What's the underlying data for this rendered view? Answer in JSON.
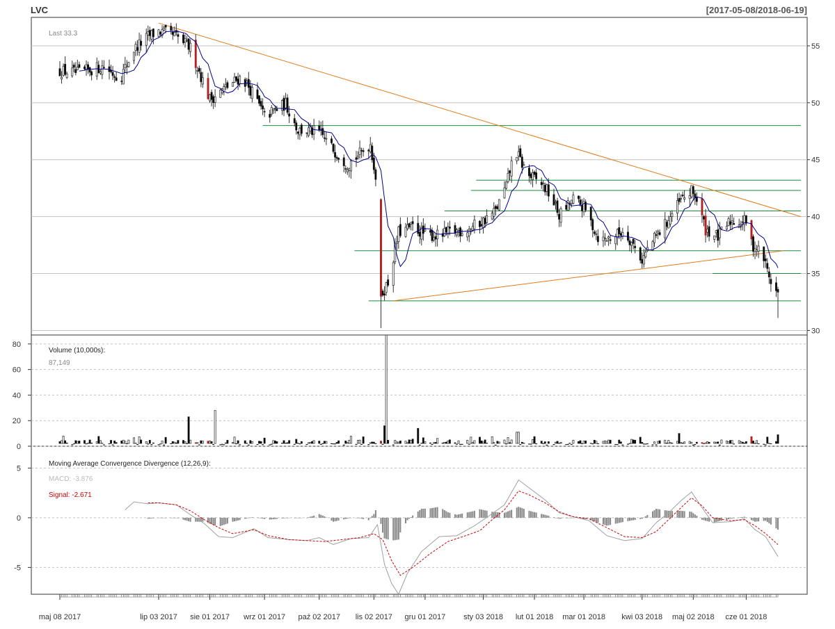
{
  "header": {
    "symbol": "LVC",
    "date_range": "[2017-05-08/2018-06-19]"
  },
  "colors": {
    "up": "#ffffff",
    "down": "#000000",
    "big_down": "#b22222",
    "ma_line": "#00008b",
    "trend_line": "#e07b1a",
    "support_line": "#1a8a3a",
    "grid": "#c0c0c0",
    "macd_line": "#a0a0a0",
    "signal_line": "#cc0000",
    "hist": "#888888"
  },
  "chart_data": [
    {
      "type": "candlestick",
      "name": "price",
      "legend": "Last 33.3",
      "ylim": [
        29.6,
        57.5
      ],
      "y_ticks": [
        30,
        35,
        40,
        45,
        50,
        55
      ],
      "x_tick_labels": [
        "maj 08 2017",
        "lip 03 2017",
        "sie 01 2017",
        "wrz 01 2017",
        "paź 02 2017",
        "lis 02 2017",
        "gru 01 2017",
        "sty 03 2018",
        "lut 01 2018",
        "mar 01 2018",
        "kwi 03 2018",
        "maj 02 2018",
        "cze 01 2018"
      ],
      "x_tick_days": [
        0,
        56,
        85,
        116,
        147,
        178,
        207,
        240,
        269,
        297,
        330,
        359,
        389
      ],
      "last_day": 407,
      "anchors": [
        [
          0,
          52.8
        ],
        [
          10,
          52.6
        ],
        [
          25,
          53.2
        ],
        [
          34,
          52.1
        ],
        [
          42,
          54.7
        ],
        [
          50,
          55.8
        ],
        [
          56,
          56.3
        ],
        [
          66,
          55.8
        ],
        [
          74,
          54.8
        ],
        [
          85,
          50.3
        ],
        [
          92,
          51.1
        ],
        [
          103,
          52.3
        ],
        [
          110,
          50.7
        ],
        [
          116,
          48.8
        ],
        [
          128,
          49.9
        ],
        [
          135,
          47.6
        ],
        [
          147,
          47.4
        ],
        [
          155,
          45.9
        ],
        [
          163,
          44.6
        ],
        [
          170,
          45.5
        ],
        [
          176,
          46.4
        ],
        [
          181,
          41.5
        ],
        [
          182,
          33.1
        ],
        [
          186,
          34.2
        ],
        [
          192,
          38.6
        ],
        [
          200,
          39.1
        ],
        [
          207,
          38.4
        ],
        [
          215,
          38.3
        ],
        [
          222,
          38.7
        ],
        [
          230,
          38.8
        ],
        [
          240,
          39.6
        ],
        [
          247,
          40.5
        ],
        [
          253,
          42.7
        ],
        [
          258,
          45.9
        ],
        [
          262,
          44.6
        ],
        [
          266,
          43.6
        ],
        [
          273,
          42.9
        ],
        [
          278,
          41.9
        ],
        [
          283,
          40.1
        ],
        [
          291,
          41.5
        ],
        [
          297,
          40.8
        ],
        [
          306,
          37.9
        ],
        [
          313,
          38.2
        ],
        [
          320,
          38.8
        ],
        [
          330,
          36.2
        ],
        [
          334,
          37.4
        ],
        [
          343,
          39.3
        ],
        [
          352,
          41.4
        ],
        [
          358,
          42.2
        ],
        [
          360,
          41.9
        ],
        [
          366,
          38.9
        ],
        [
          373,
          38.2
        ],
        [
          380,
          39.6
        ],
        [
          389,
          39.6
        ],
        [
          392,
          37.6
        ],
        [
          398,
          36.8
        ],
        [
          402,
          34.8
        ],
        [
          405,
          33.5
        ],
        [
          407,
          33.3
        ]
      ],
      "ma_period": 10,
      "trend_lines": [
        {
          "from": [
            56,
            57.0
          ],
          "to": [
            420,
            40.0
          ]
        },
        {
          "from": [
            189,
            32.6
          ],
          "to": [
            410,
            37.0
          ]
        }
      ],
      "support_lines": [
        {
          "y": 48.0,
          "from": 115,
          "to": 420
        },
        {
          "y": 43.2,
          "from": 236,
          "to": 420
        },
        {
          "y": 42.3,
          "from": 233,
          "to": 420
        },
        {
          "y": 40.5,
          "from": 218,
          "to": 420
        },
        {
          "y": 37.0,
          "from": 167,
          "to": 420
        },
        {
          "y": 35.0,
          "from": 370,
          "to": 420
        },
        {
          "y": 32.6,
          "from": 175,
          "to": 420
        }
      ]
    },
    {
      "type": "bar",
      "name": "volume",
      "legend": "Volume (10,000s):",
      "last_value": "87,149",
      "ylim": [
        0,
        87
      ],
      "y_ticks": [
        0,
        20,
        40,
        60,
        80
      ],
      "spikes": [
        [
          2,
          8
        ],
        [
          34,
          19
        ],
        [
          73,
          23
        ],
        [
          88,
          28
        ],
        [
          90,
          15
        ],
        [
          111,
          12
        ],
        [
          131,
          22
        ],
        [
          185,
          87
        ],
        [
          184,
          16
        ],
        [
          180,
          12
        ],
        [
          203,
          14
        ],
        [
          259,
          11
        ],
        [
          260,
          11
        ],
        [
          348,
          11
        ],
        [
          351,
          10
        ],
        [
          362,
          9
        ],
        [
          407,
          9
        ]
      ]
    },
    {
      "type": "line",
      "name": "macd",
      "legend": "Moving Average Convergence Divergence (12,26,9):",
      "macd_label": "MACD: -3.876",
      "signal_label": "Signal: -2.671",
      "ylim": [
        -7.7,
        7.2
      ],
      "y_ticks": [
        -5,
        0,
        5
      ],
      "macd_points": [
        [
          37,
          0.8
        ],
        [
          42,
          1.6
        ],
        [
          50,
          1.4
        ],
        [
          56,
          1.5
        ],
        [
          66,
          1.3
        ],
        [
          74,
          0.3
        ],
        [
          82,
          -0.6
        ],
        [
          90,
          -1.9
        ],
        [
          98,
          -2.0
        ],
        [
          110,
          -1.1
        ],
        [
          118,
          -2.0
        ],
        [
          130,
          -2.2
        ],
        [
          140,
          -2.3
        ],
        [
          147,
          -2.0
        ],
        [
          155,
          -2.7
        ],
        [
          165,
          -2.1
        ],
        [
          175,
          -2.0
        ],
        [
          180,
          -0.7
        ],
        [
          184,
          -4.7
        ],
        [
          188,
          -6.6
        ],
        [
          192,
          -7.7
        ],
        [
          197,
          -5.6
        ],
        [
          205,
          -3.4
        ],
        [
          215,
          -1.9
        ],
        [
          225,
          -1.8
        ],
        [
          235,
          -0.8
        ],
        [
          245,
          0.4
        ],
        [
          252,
          1.3
        ],
        [
          260,
          3.8
        ],
        [
          266,
          3.0
        ],
        [
          275,
          1.8
        ],
        [
          283,
          0.5
        ],
        [
          291,
          0.1
        ],
        [
          300,
          -0.3
        ],
        [
          310,
          -1.8
        ],
        [
          320,
          -2.3
        ],
        [
          330,
          -2.1
        ],
        [
          338,
          -0.5
        ],
        [
          345,
          0.5
        ],
        [
          352,
          1.7
        ],
        [
          358,
          2.6
        ],
        [
          364,
          1.0
        ],
        [
          370,
          -0.5
        ],
        [
          380,
          -0.4
        ],
        [
          388,
          -0.1
        ],
        [
          394,
          -1.2
        ],
        [
          400,
          -1.9
        ],
        [
          407,
          -3.9
        ]
      ],
      "signal_points": [
        [
          50,
          1.5
        ],
        [
          56,
          1.5
        ],
        [
          66,
          1.3
        ],
        [
          74,
          0.7
        ],
        [
          82,
          -0.2
        ],
        [
          90,
          -1.0
        ],
        [
          98,
          -1.6
        ],
        [
          110,
          -1.2
        ],
        [
          118,
          -1.8
        ],
        [
          130,
          -2.2
        ],
        [
          140,
          -2.3
        ],
        [
          150,
          -2.4
        ],
        [
          160,
          -2.2
        ],
        [
          170,
          -2.0
        ],
        [
          178,
          -1.6
        ],
        [
          183,
          -2.2
        ],
        [
          188,
          -4.3
        ],
        [
          193,
          -5.8
        ],
        [
          200,
          -5.0
        ],
        [
          210,
          -3.6
        ],
        [
          220,
          -2.4
        ],
        [
          230,
          -1.8
        ],
        [
          238,
          -1.3
        ],
        [
          245,
          -0.2
        ],
        [
          252,
          0.8
        ],
        [
          260,
          2.7
        ],
        [
          266,
          2.3
        ],
        [
          275,
          1.5
        ],
        [
          283,
          0.6
        ],
        [
          291,
          0.1
        ],
        [
          300,
          -0.1
        ],
        [
          310,
          -1.0
        ],
        [
          320,
          -1.9
        ],
        [
          330,
          -2.0
        ],
        [
          338,
          -1.4
        ],
        [
          345,
          -0.2
        ],
        [
          352,
          1.0
        ],
        [
          358,
          2.0
        ],
        [
          364,
          1.2
        ],
        [
          370,
          0.0
        ],
        [
          380,
          -0.3
        ],
        [
          388,
          -0.2
        ],
        [
          394,
          -0.8
        ],
        [
          400,
          -1.6
        ],
        [
          407,
          -2.7
        ]
      ]
    }
  ]
}
